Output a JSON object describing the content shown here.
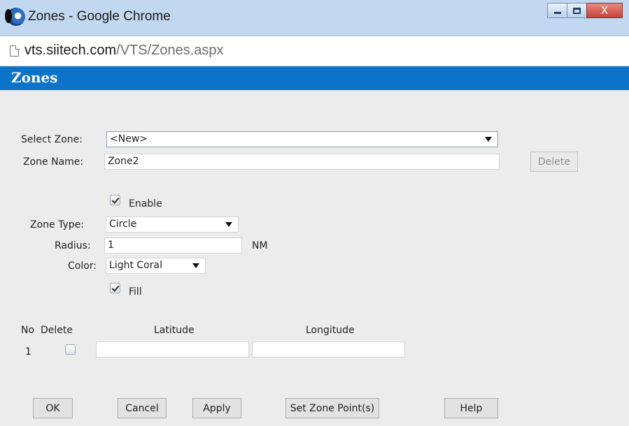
{
  "window": {
    "title": "Zones - Google Chrome",
    "close_label": "X"
  },
  "address": {
    "host": "vts.siitech.com",
    "path": "/VTS/Zones.aspx"
  },
  "header": {
    "title": "Zones"
  },
  "form": {
    "select_zone_label": "Select Zone:",
    "select_zone_value": "<New>",
    "zone_name_label": "Zone Name:",
    "zone_name_value": "Zone2",
    "delete_label": "Delete",
    "enable_label": "Enable",
    "enable_checked": true,
    "zone_type_label": "Zone Type:",
    "zone_type_value": "Circle",
    "radius_label": "Radius:",
    "radius_value": "1",
    "radius_unit": "NM",
    "color_label": "Color:",
    "color_value": "Light Coral",
    "fill_label": "Fill",
    "fill_checked": true
  },
  "points_table": {
    "headers": [
      "No",
      "Delete",
      "Latitude",
      "Longitude"
    ],
    "rows": [
      {
        "no": "1",
        "delete_checked": false,
        "latitude": "",
        "longitude": ""
      }
    ]
  },
  "buttons": {
    "ok": "OK",
    "cancel": "Cancel",
    "apply": "Apply",
    "set_zone_points": "Set Zone Point(s)",
    "help": "Help"
  },
  "colors": {
    "header_band": "#0b73c8",
    "titlebar": "#c2d8f0",
    "body_bg": "#ececec"
  }
}
